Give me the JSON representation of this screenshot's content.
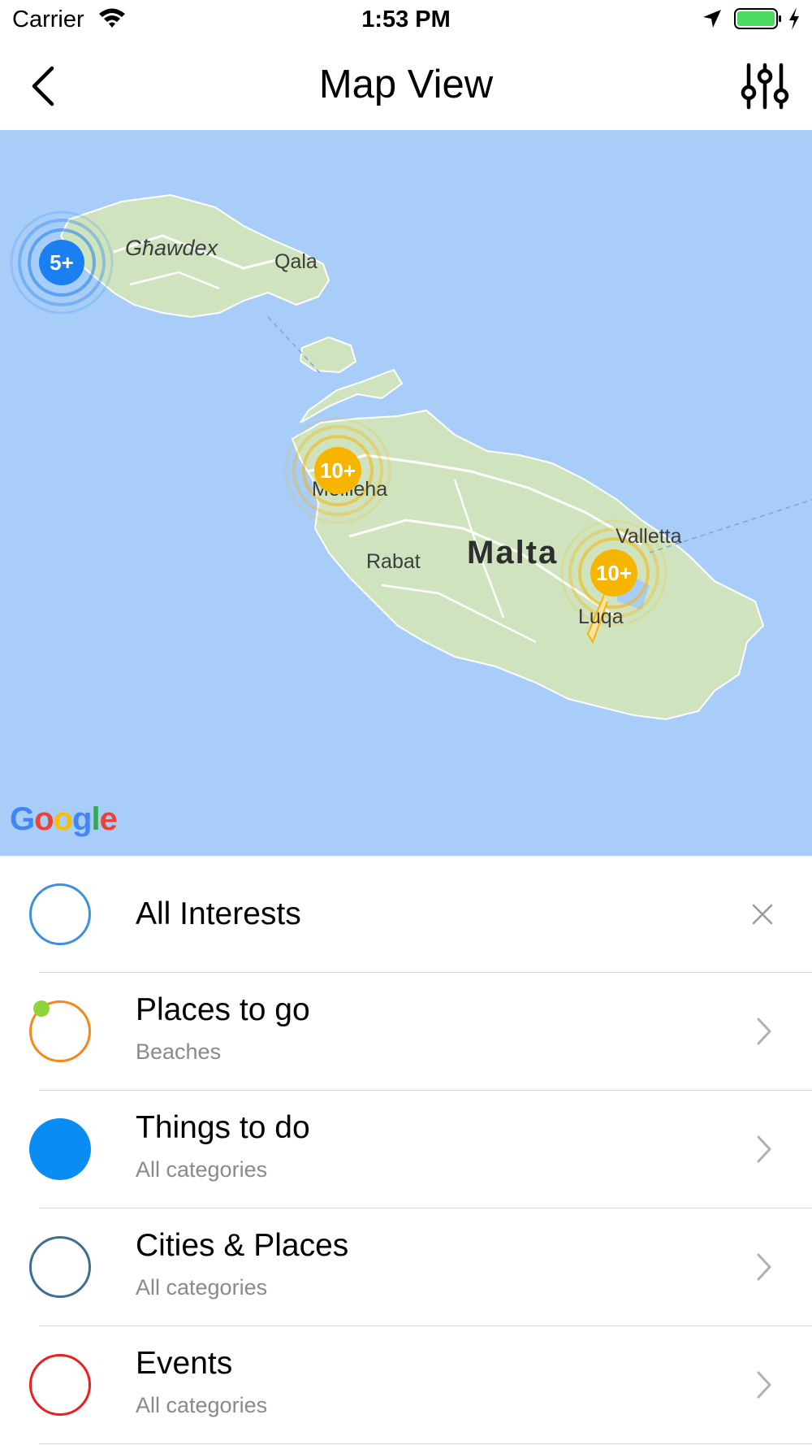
{
  "status_bar": {
    "carrier": "Carrier",
    "time": "1:53 PM"
  },
  "nav": {
    "title": "Map View"
  },
  "map": {
    "labels": {
      "gozo": "Għawdex",
      "qala": "Qala",
      "mellieha": "Mellieha",
      "malta": "Malta",
      "rabat": "Rabat",
      "valletta": "Valletta",
      "luqa": "Luqa"
    },
    "clusters": [
      {
        "label": "5+",
        "color": "#1a7ff0"
      },
      {
        "label": "10+",
        "color": "#f7b500"
      },
      {
        "label": "10+",
        "color": "#f7b500"
      }
    ],
    "attribution": "Google"
  },
  "list": {
    "items": [
      {
        "title": "All Interests",
        "subtitle": "",
        "ring_color": "#3f8fe0",
        "action": "close-icon"
      },
      {
        "title": "Places to go",
        "subtitle": "Beaches",
        "ring_color": "#f5871f",
        "action": "chevron-right-icon"
      },
      {
        "title": "Things to do",
        "subtitle": "All categories",
        "ring_color": "#0a8cf5",
        "filled": true,
        "action": "chevron-right-icon"
      },
      {
        "title": "Cities & Places",
        "subtitle": "All categories",
        "ring_color": "#3e6f8e",
        "action": "chevron-right-icon"
      },
      {
        "title": "Events",
        "subtitle": "All categories",
        "ring_color": "#e8211f",
        "action": "chevron-right-icon"
      }
    ]
  }
}
